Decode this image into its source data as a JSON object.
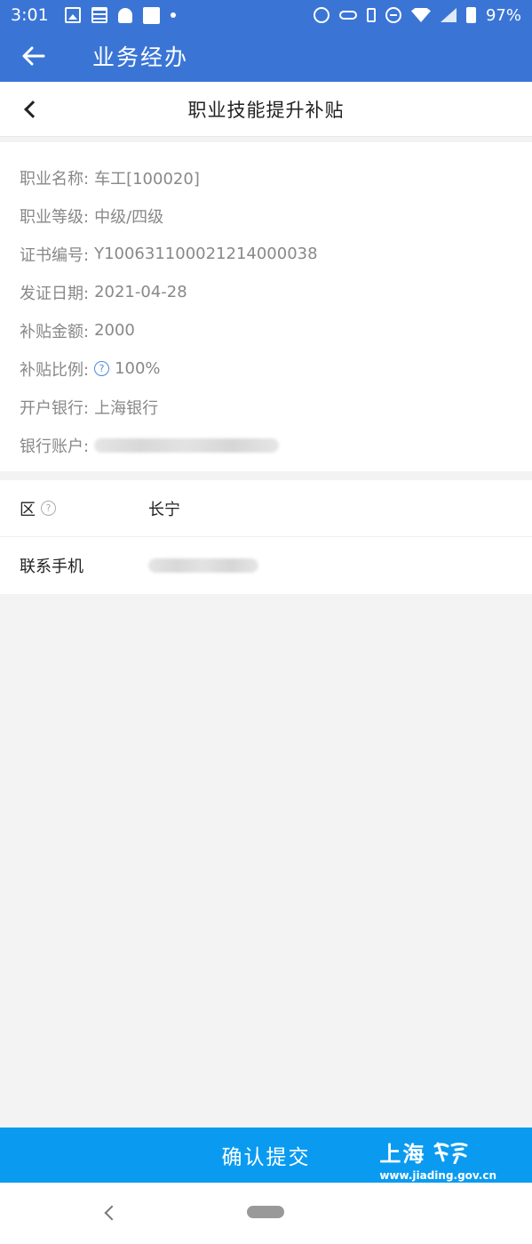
{
  "status_bar": {
    "time": "3:01",
    "battery": "97%"
  },
  "app_bar": {
    "title": "业务经办"
  },
  "page": {
    "title": "职业技能提升补贴"
  },
  "info": [
    {
      "label": "职业名称:",
      "value": "车工[100020]"
    },
    {
      "label": "职业等级:",
      "value": "中级/四级"
    },
    {
      "label": "证书编号:",
      "value": "Y10063110002121400003​8"
    },
    {
      "label": "发证日期:",
      "value": "2021-04-28"
    },
    {
      "label": "补贴金额:",
      "value": "2000"
    },
    {
      "label": "补贴比例:",
      "value": "100%"
    },
    {
      "label": "开户银行:",
      "value": "上海银行"
    },
    {
      "label": "银行账户:",
      "value": ""
    }
  ],
  "form": {
    "district": {
      "label": "区",
      "value": "长宁"
    },
    "phone": {
      "label": "联系手机",
      "value": ""
    }
  },
  "submit": {
    "label": "确认提交"
  },
  "watermark": {
    "title": "上海",
    "url": "www.jiading.gov.cn"
  }
}
